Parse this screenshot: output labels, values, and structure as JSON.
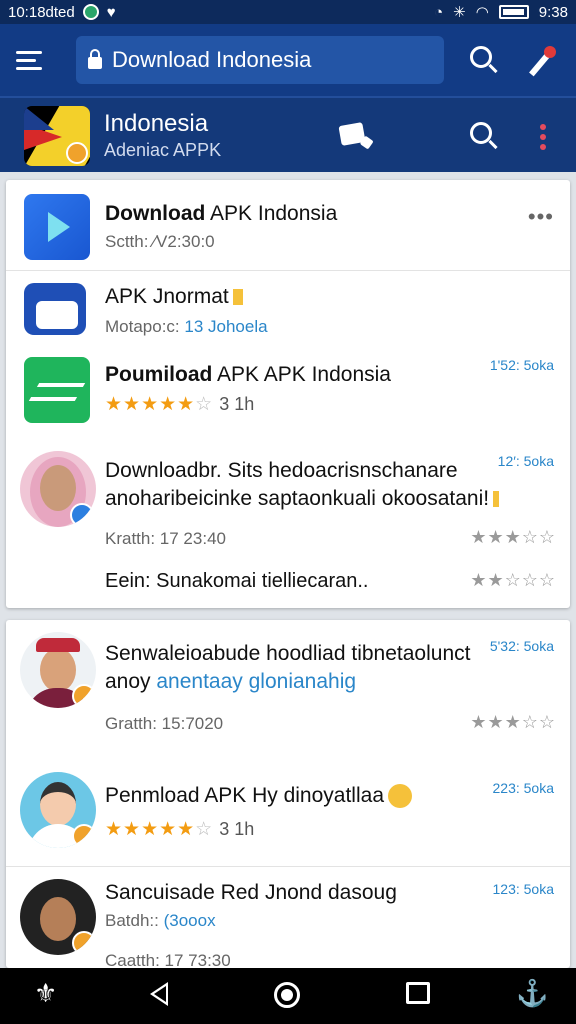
{
  "status_bar": {
    "time_left": "10:18dted",
    "time_right": "9:38"
  },
  "top_bar": {
    "url": "Download Indonesia"
  },
  "app_bar": {
    "title": "Indonesia",
    "subtitle": "Adeniac APPK"
  },
  "card1": {
    "items": [
      {
        "name_bold": "Download",
        "name_rest": " APK Indonsia",
        "meta": "Sctth: ∕V2:30:0"
      },
      {
        "name": "APK Jnormat",
        "meta_label": "Motapo:c: ",
        "meta_link": "13 Johoela"
      },
      {
        "name_bold": "Poumiload",
        "name_rest": " APK APK Indonsia",
        "time": "1'52: 5oka",
        "rating": "4.5",
        "duration": "3 1h"
      },
      {
        "line1": "Downloadbr. Sits hedoacrisnschanare",
        "line2": "anoharibeicinke saptaonkuali okoosatani!",
        "time": "12′: 5oka",
        "meta": "Kratth:  17 23:40"
      },
      {
        "text": "Eein: Sunakomai tielliecaran.."
      }
    ]
  },
  "card2": {
    "items": [
      {
        "line1": "Senwaleioabude hoodliad tibnetaolunct",
        "line2_prefix": "anoy ",
        "line2_link": "anentaay glonianahig",
        "time": "5'32: 5oka",
        "meta": "Gratth:  15:7020"
      },
      {
        "name": "Penmload APK Hy dinoyatllaa",
        "time": "223: 5oka",
        "duration": "3 1h"
      },
      {
        "name": "Sancuisade Red Jnond dasoug",
        "meta_label": "Batdh:: ",
        "meta_link": "(3ooox",
        "time": "123: 5oka",
        "meta2": "Caatth:  17 73:30"
      }
    ]
  },
  "colors": {
    "topbar": "#123b85",
    "appbar": "#14397a",
    "accent_link": "#2a86c9",
    "star": "#f39c12"
  }
}
